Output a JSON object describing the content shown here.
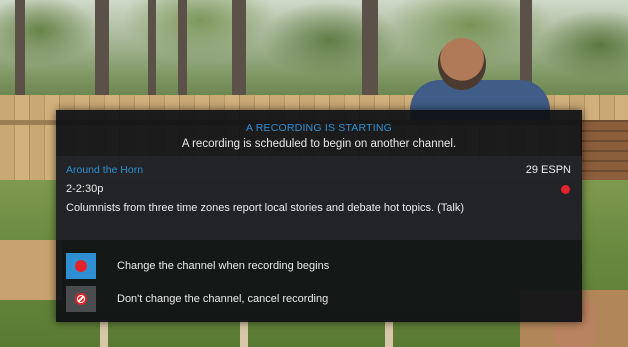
{
  "dialog": {
    "title": "A RECORDING IS STARTING",
    "subtitle": "A recording is scheduled to begin on another channel.",
    "program": {
      "title": "Around the Horn",
      "channel": "29  ESPN",
      "time": "2-2:30p",
      "description": "Columnists from three time zones report local stories and debate hot topics. (Talk)",
      "recording_indicator": "record-dot-icon"
    },
    "options": [
      {
        "label": "Change the channel when recording begins",
        "icon": "record-icon",
        "selected": true
      },
      {
        "label": "Don't change the channel, cancel recording",
        "icon": "cancel-icon",
        "selected": false
      }
    ]
  },
  "colors": {
    "accent": "#2f8fd3",
    "record": "#e3232c",
    "panel": "#0e1014",
    "text": "#ececec"
  }
}
